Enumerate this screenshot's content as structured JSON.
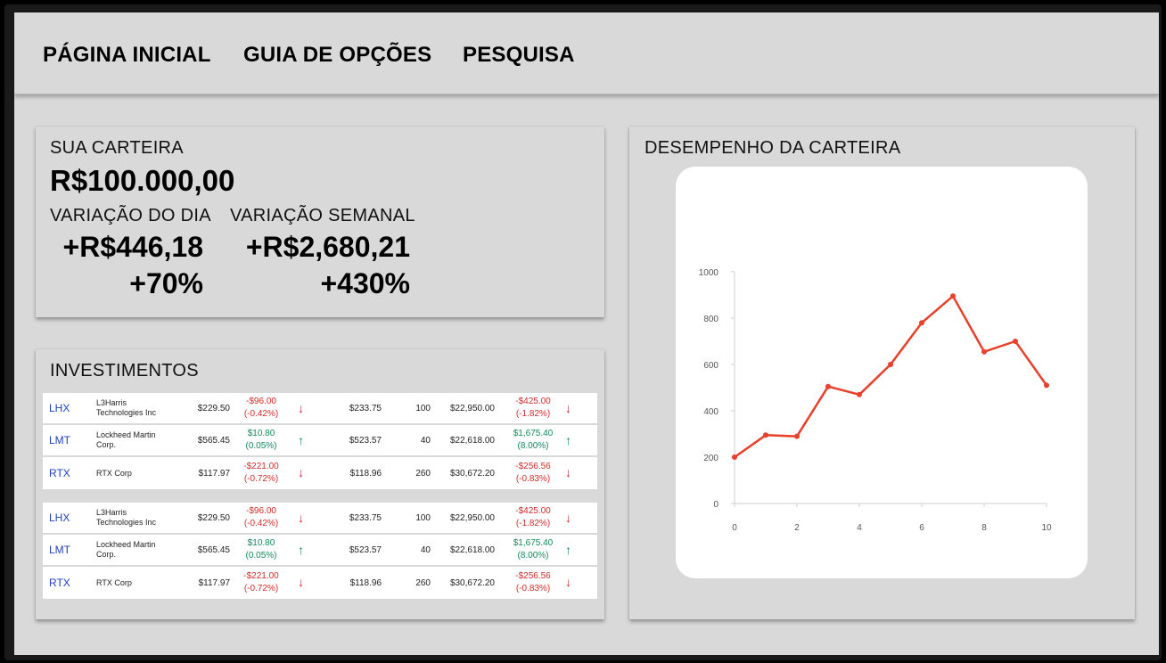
{
  "nav": {
    "items": [
      {
        "label": "PÁGINA INICIAL"
      },
      {
        "label": "GUIA DE OPÇÕES"
      },
      {
        "label": "PESQUISA"
      }
    ]
  },
  "portfolio": {
    "title": "SUA CARTEIRA",
    "total": "R$100.000,00",
    "daily_label": "VARIAÇÃO DO DIA",
    "daily_value": "+R$446,18",
    "daily_pct": "+70%",
    "weekly_label": "VARIAÇÃO SEMANAL",
    "weekly_value": "+R$2,680,21",
    "weekly_pct": "+430%"
  },
  "investments": {
    "title": "INVESTIMENTOS",
    "tables": [
      {
        "rows": [
          {
            "symbol": "LHX",
            "name": "L3Harris Technologies Inc",
            "price": "$229.50",
            "change": "-$96.00",
            "change_pct": "(-0.42%)",
            "dir": "down",
            "prev": "$233.75",
            "qty": "100",
            "value": "$22,950.00",
            "gain": "-$425.00",
            "gain_pct": "(-1.82%)",
            "gain_dir": "down"
          },
          {
            "symbol": "LMT",
            "name": "Lockheed Martin Corp.",
            "price": "$565.45",
            "change": "$10.80",
            "change_pct": "(0.05%)",
            "dir": "up",
            "prev": "$523.57",
            "qty": "40",
            "value": "$22,618.00",
            "gain": "$1,675.40",
            "gain_pct": "(8.00%)",
            "gain_dir": "up"
          },
          {
            "symbol": "RTX",
            "name": "RTX Corp",
            "price": "$117.97",
            "change": "-$221.00",
            "change_pct": "(-0.72%)",
            "dir": "down",
            "prev": "$118.96",
            "qty": "260",
            "value": "$30,672.20",
            "gain": "-$256.56",
            "gain_pct": "(-0.83%)",
            "gain_dir": "down"
          }
        ]
      },
      {
        "rows": [
          {
            "symbol": "LHX",
            "name": "L3Harris Technologies Inc",
            "price": "$229.50",
            "change": "-$96.00",
            "change_pct": "(-0.42%)",
            "dir": "down",
            "prev": "$233.75",
            "qty": "100",
            "value": "$22,950.00",
            "gain": "-$425.00",
            "gain_pct": "(-1.82%)",
            "gain_dir": "down"
          },
          {
            "symbol": "LMT",
            "name": "Lockheed Martin Corp.",
            "price": "$565.45",
            "change": "$10.80",
            "change_pct": "(0.05%)",
            "dir": "up",
            "prev": "$523.57",
            "qty": "40",
            "value": "$22,618.00",
            "gain": "$1,675.40",
            "gain_pct": "(8.00%)",
            "gain_dir": "up"
          },
          {
            "symbol": "RTX",
            "name": "RTX Corp",
            "price": "$117.97",
            "change": "-$221.00",
            "change_pct": "(-0.72%)",
            "dir": "down",
            "prev": "$118.96",
            "qty": "260",
            "value": "$30,672.20",
            "gain": "-$256.56",
            "gain_pct": "(-0.83%)",
            "gain_dir": "down"
          }
        ]
      }
    ]
  },
  "performance": {
    "title": "DESEMPENHO DA CARTEIRA"
  },
  "chart_data": {
    "type": "line",
    "x": [
      0,
      1,
      2,
      3,
      4,
      5,
      6,
      7,
      8,
      9,
      10
    ],
    "series": [
      {
        "values": [
          200,
          295,
          290,
          505,
          470,
          600,
          780,
          895,
          655,
          700,
          510
        ]
      }
    ],
    "xlim": [
      0,
      10
    ],
    "ylim": [
      0,
      1000
    ],
    "xticks": [
      0,
      2,
      4,
      6,
      8,
      10
    ],
    "yticks": [
      0,
      200,
      400,
      600,
      800,
      1000
    ],
    "line_color": "#e8402a",
    "grid": false,
    "title": "",
    "xlabel": "",
    "ylabel": ""
  },
  "colors": {
    "negative": "#d42a2a",
    "positive": "#108a5a",
    "symbol": "#1f3fbf"
  }
}
